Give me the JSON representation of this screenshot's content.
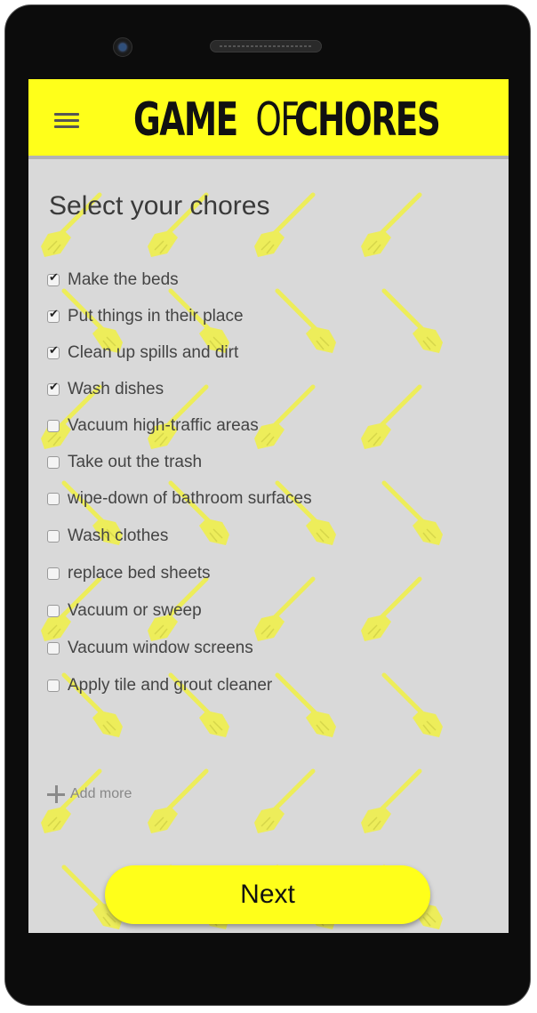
{
  "app": {
    "logo_part1": "GAME",
    "logo_part2": "OF",
    "logo_part3": "CHORES",
    "menu_icon": "hamburger-menu-icon",
    "accent_color": "#ffff1a",
    "background_color": "#d9d9d9",
    "pattern_icon": "broom-icon"
  },
  "main": {
    "title": "Select your chores",
    "chores": [
      {
        "label": "Make the beds",
        "checked": true
      },
      {
        "label": "Put things in their place",
        "checked": true
      },
      {
        "label": "Clean up spills and dirt",
        "checked": true
      },
      {
        "label": "Wash dishes",
        "checked": true
      },
      {
        "label": "Vacuum high-traffic areas",
        "checked": false
      },
      {
        "label": "Take out the trash",
        "checked": false
      },
      {
        "label": "wipe-down of bathroom surfaces",
        "checked": false
      },
      {
        "label": "Wash clothes",
        "checked": false
      },
      {
        "label": " replace bed sheets",
        "checked": false
      },
      {
        "label": "Vacuum or sweep",
        "checked": false
      },
      {
        "label": "Vacuum window screens",
        "checked": false
      },
      {
        "label": "Apply tile and grout cleaner",
        "checked": false
      }
    ],
    "add_more_label": "Add more",
    "add_icon": "plus-icon"
  },
  "footer": {
    "next_label": "Next"
  }
}
